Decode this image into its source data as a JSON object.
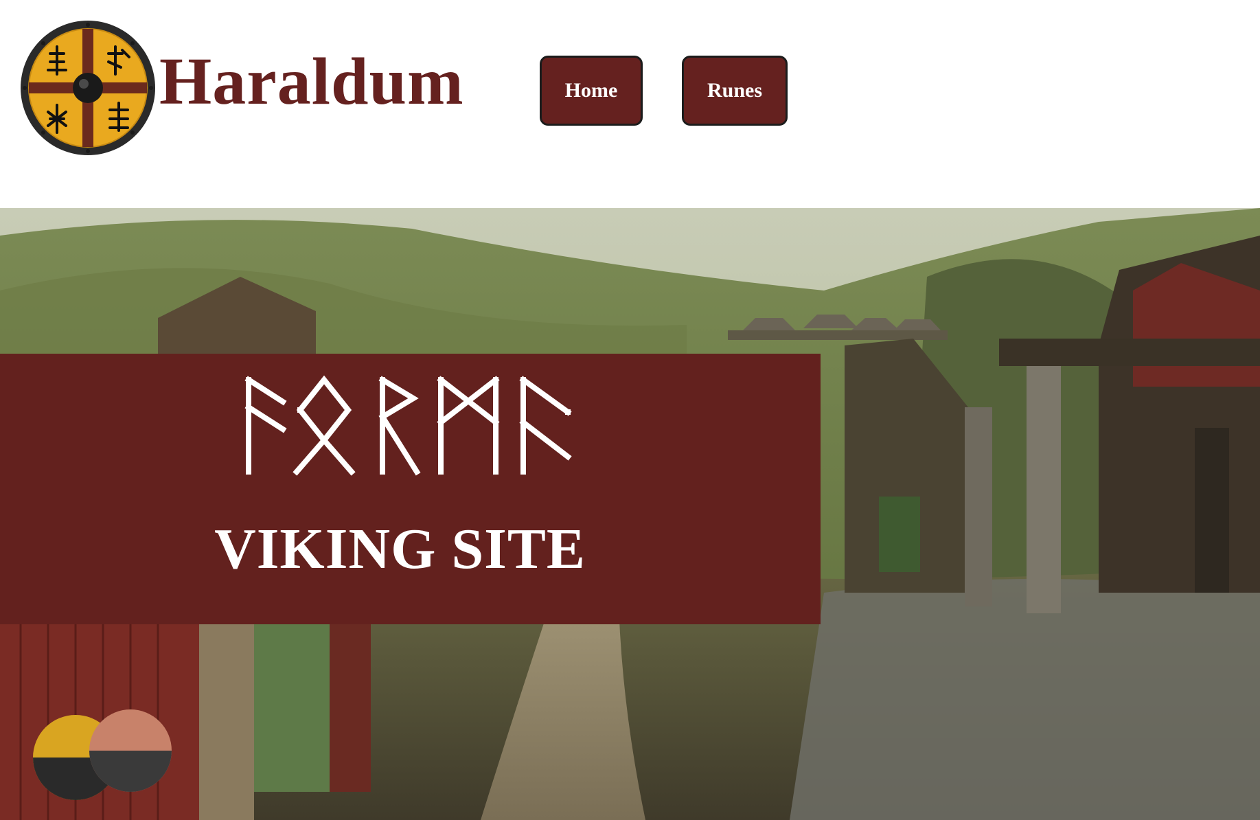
{
  "site": {
    "title": "Haraldum",
    "brand_color": "#65211f"
  },
  "nav": {
    "home_label": "Home",
    "runes_label": "Runes"
  },
  "hero": {
    "rune_text": "ᚠᛟᚱᛗᛖ",
    "heading": "VIKING SITE",
    "panel_color": "#63211e"
  },
  "icons": {
    "logo": "viking-shield-logo-icon"
  }
}
